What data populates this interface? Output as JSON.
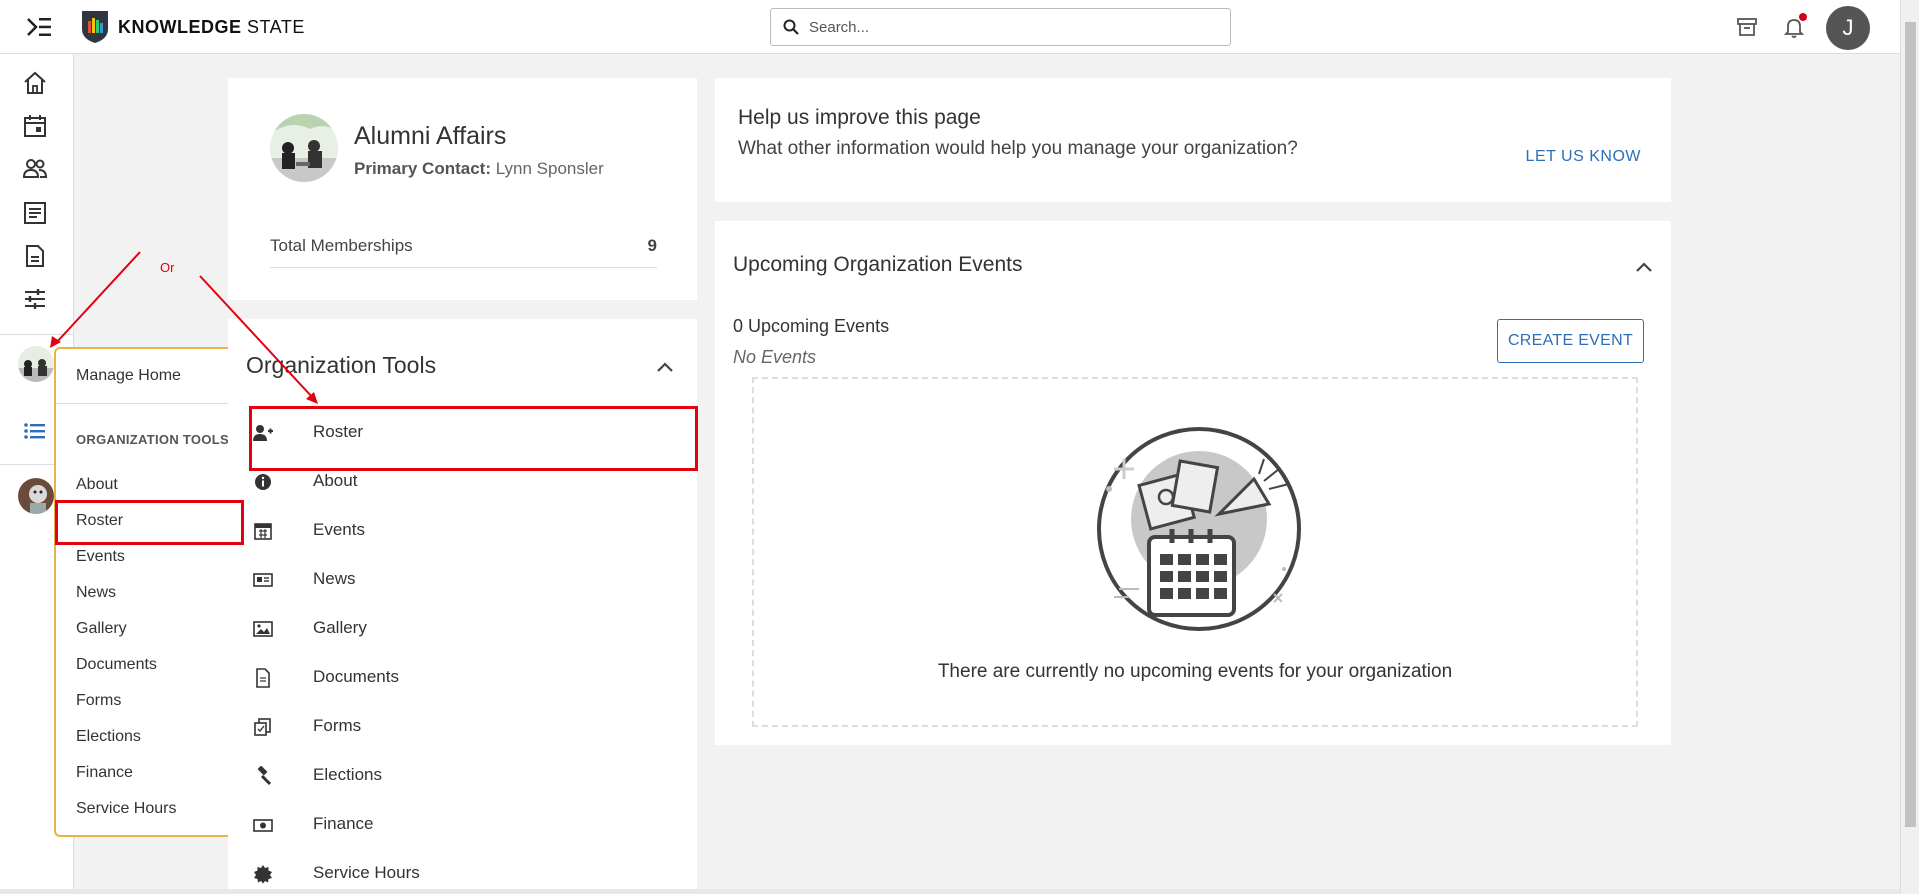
{
  "header": {
    "logo_text_bold": "KNOWLEDGE",
    "logo_text_light": "STATE",
    "search_placeholder": "Search...",
    "user_initial": "J"
  },
  "flyout": {
    "manage_home": "Manage Home",
    "section_title": "ORGANIZATION TOOLS",
    "items": [
      "About",
      "Roster",
      "Events",
      "News",
      "Gallery",
      "Documents",
      "Forms",
      "Elections",
      "Finance",
      "Service Hours"
    ]
  },
  "annotation": {
    "or_label": "Or"
  },
  "org": {
    "name": "Alumni Affairs",
    "primary_contact_label": "Primary Contact:",
    "primary_contact": "Lynn Sponsler",
    "total_memberships_label": "Total Memberships",
    "total_memberships": "9"
  },
  "tools": {
    "title": "Organization Tools",
    "items": [
      {
        "label": "Roster",
        "icon": "user-plus-icon"
      },
      {
        "label": "About",
        "icon": "info-icon"
      },
      {
        "label": "Events",
        "icon": "calendar-icon"
      },
      {
        "label": "News",
        "icon": "newspaper-icon"
      },
      {
        "label": "Gallery",
        "icon": "image-icon"
      },
      {
        "label": "Documents",
        "icon": "document-icon"
      },
      {
        "label": "Forms",
        "icon": "forms-icon"
      },
      {
        "label": "Elections",
        "icon": "gavel-icon"
      },
      {
        "label": "Finance",
        "icon": "money-icon"
      },
      {
        "label": "Service Hours",
        "icon": "badge-icon"
      }
    ]
  },
  "help": {
    "title": "Help us improve this page",
    "subtitle": "What other information would help you manage your organization?",
    "link": "LET US KNOW"
  },
  "events": {
    "title": "Upcoming Organization Events",
    "count_text": "0 Upcoming Events",
    "none_text": "No Events",
    "create_button": "CREATE EVENT",
    "empty_message": "There are currently no upcoming events for your organization"
  },
  "colors": {
    "accent": "#2c6fb7",
    "annotation_red": "#e3000f",
    "flyout_border": "#e8b44a"
  }
}
